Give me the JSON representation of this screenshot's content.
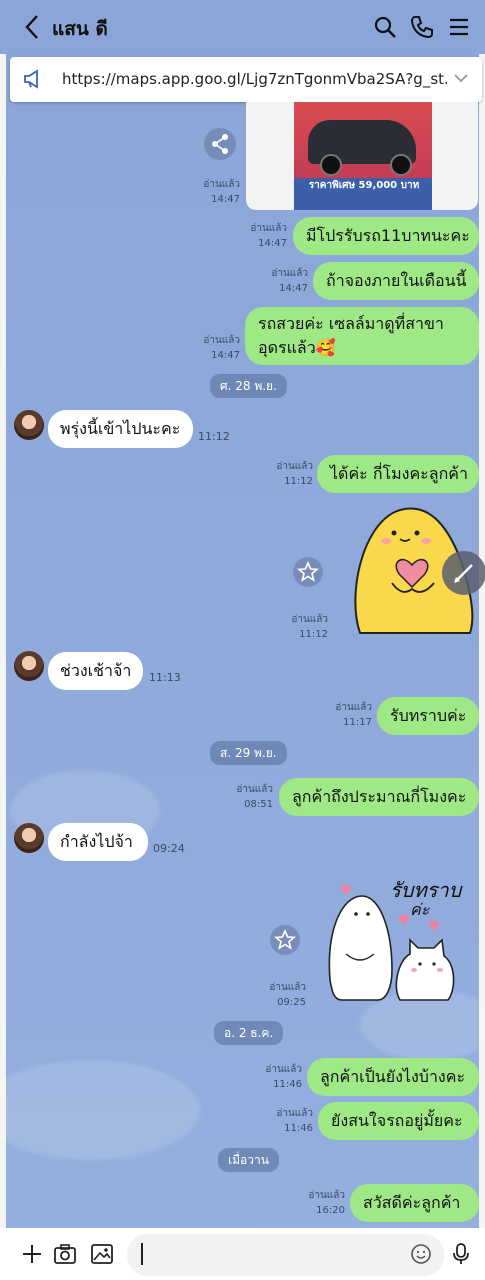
{
  "header": {
    "title": "แสน ดี"
  },
  "link": {
    "url": "https://maps.app.goo.gl/Ljg7znTgonmVba2SA?g_st..."
  },
  "image_card": {
    "poster_price": "ราคาพิเศษ 59,000 บาท",
    "read": "อ่านแล้ว",
    "time": "14:47"
  },
  "messages": [
    {
      "id": "m1",
      "side": "out",
      "text": "มีโปรรับรถ11บาทนะคะ",
      "read": "อ่านแล้ว",
      "time": "14:47"
    },
    {
      "id": "m2",
      "side": "out",
      "text": "ถ้าจองภายในเดือนนี้",
      "read": "อ่านแล้ว",
      "time": "14:47"
    },
    {
      "id": "m3",
      "side": "out",
      "line1": "รถสวยค่ะ เซลล์มาดูที่สาขา",
      "line2": "อุดรแล้ว🥰",
      "read": "อ่านแล้ว",
      "time": "14:47"
    },
    {
      "id": "m4",
      "side": "in",
      "text": "พรุ่งนี้เข้าไปนะคะ",
      "time": "11:12"
    },
    {
      "id": "m5",
      "side": "out",
      "text": "ได้ค่ะ กี่โมงคะลูกค้า",
      "read": "อ่านแล้ว",
      "time": "11:12"
    },
    {
      "id": "m6",
      "side": "out",
      "sticker": true,
      "read": "อ่านแล้ว",
      "time": "11:12"
    },
    {
      "id": "m7",
      "side": "in",
      "text": "ช่วงเช้าจ้า",
      "time": "11:13"
    },
    {
      "id": "m8",
      "side": "out",
      "text": "รับทราบค่ะ",
      "read": "อ่านแล้ว",
      "time": "11:17"
    },
    {
      "id": "m9",
      "side": "out",
      "text": "ลูกค้าถึงประมาณกี่โมงคะ",
      "read": "อ่านแล้ว",
      "time": "08:51"
    },
    {
      "id": "m10",
      "side": "in",
      "text": "กำลังไปจ้า",
      "time": "09:24"
    },
    {
      "id": "m11",
      "side": "out",
      "sticker": true,
      "sticker_text1": "รับทราบ",
      "sticker_text2": "ค่ะ",
      "read": "อ่านแล้ว",
      "time": "09:25"
    },
    {
      "id": "m12",
      "side": "out",
      "text": "ลูกค้าเป็นยังไงบ้างคะ",
      "read": "อ่านแล้ว",
      "time": "11:46"
    },
    {
      "id": "m13",
      "side": "out",
      "text": "ยังสนใจรถอยู่มั้ยคะ",
      "read": "อ่านแล้ว",
      "time": "11:46"
    },
    {
      "id": "m14",
      "side": "out",
      "text": "สวัสดีค่ะลูกค้า",
      "read": "อ่านแล้ว",
      "time": "16:20"
    }
  ],
  "dates": [
    "ศ. 28 พ.ย.",
    "ส. 29 พ.ย.",
    "อ. 2 ธ.ค.",
    "เมื่อวาน"
  ],
  "colors": {
    "background": "#8aa6d8",
    "outgoing_bubble": "#9fe886",
    "incoming_bubble": "#ffffff"
  },
  "icons": {
    "back": "chevron-left-icon",
    "search": "search-icon",
    "call": "phone-icon",
    "menu": "menu-icon",
    "link": "megaphone-icon",
    "share": "share-icon",
    "edit": "pencil-icon",
    "favorite": "star-icon",
    "add": "plus-icon",
    "camera": "camera-icon",
    "gallery": "image-icon",
    "emoji": "smiley-icon",
    "voice": "microphone-icon"
  }
}
